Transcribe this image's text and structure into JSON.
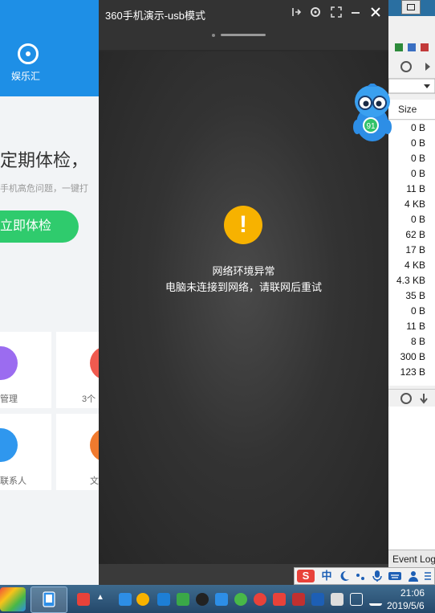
{
  "main_window": {
    "title": "360手机演示-usb模式",
    "icons": {
      "pin": "pin-icon",
      "settings": "gear-icon",
      "fullscreen": "expand-icon",
      "minimize": "minimize-icon",
      "close": "close-icon"
    },
    "error_title": "网络环境异常",
    "error_message": "电脑未连接到网络，请联网后重试",
    "warning_symbol": "!",
    "warning_color": "#f7b200"
  },
  "left_app": {
    "nav_label": "娱乐汇",
    "checkup_title": "定期体检，",
    "checkup_subtitle": "手机高危问题，一键打",
    "checkup_button": "立即体检",
    "tiles": [
      {
        "label": "管理",
        "color": "#9b6cf0"
      },
      {
        "label": "3个",
        "color": "#ef5a4f"
      },
      {
        "label": "联系人",
        "color": "#2f97ee"
      },
      {
        "label": "文",
        "color": "#f07a2e"
      }
    ],
    "accent": "#1e8fe6",
    "button_color": "#2fcb6d"
  },
  "right_app": {
    "column_header": "Size",
    "sizes": [
      "0 B",
      "0 B",
      "0 B",
      "0 B",
      "11 B",
      "4 KB",
      "0 B",
      "62 B",
      "17 B",
      "4 KB",
      "4.3 KB",
      "35 B",
      "0 B",
      "11 B",
      "8 B",
      "300 B",
      "123 B"
    ],
    "bottom_tab": "Event Log"
  },
  "mascot_badge": "91",
  "ime": {
    "mode": "中"
  },
  "taskbar": {
    "time": "21:06",
    "date": "2019/5/6"
  }
}
